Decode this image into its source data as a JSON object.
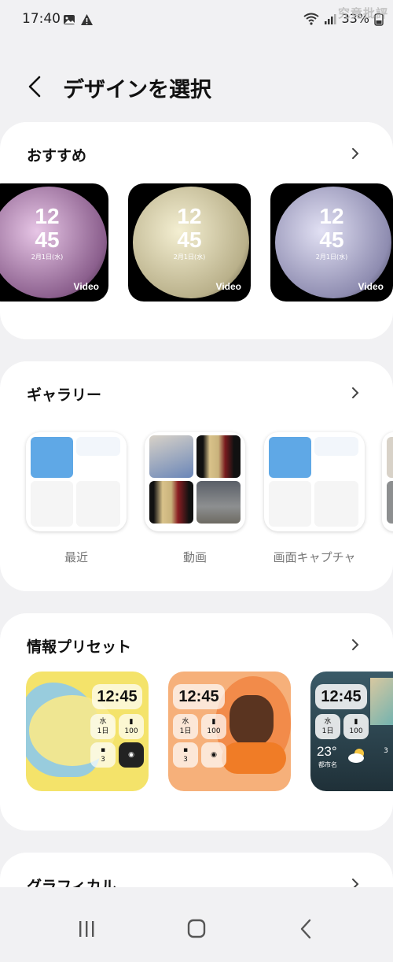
{
  "status": {
    "time": "17:40",
    "battery": "33%",
    "watermark": "究竟批評"
  },
  "header": {
    "title": "デザインを選択"
  },
  "sections": {
    "recommended": {
      "title": "おすすめ",
      "items": [
        {
          "time_h": "12",
          "time_m": "45",
          "date": "2月1日(水)",
          "badge": "Video",
          "tint": "#c9a6c9"
        },
        {
          "time_h": "12",
          "time_m": "45",
          "date": "2月1日(水)",
          "badge": "Video",
          "tint": "#d9d2b2"
        },
        {
          "time_h": "12",
          "time_m": "45",
          "date": "2月1日(水)",
          "badge": "Video",
          "tint": "#b8b6d4"
        }
      ]
    },
    "gallery": {
      "title": "ギャラリー",
      "items": [
        {
          "label": "最近"
        },
        {
          "label": "動画"
        },
        {
          "label": "画面キャプチャ"
        }
      ]
    },
    "presets": {
      "title": "情報プリセット",
      "items": [
        {
          "clock": "12:45",
          "day": "水",
          "date": "1日",
          "battery": "100",
          "count": "3",
          "bg": "#f4e36a"
        },
        {
          "clock": "12:45",
          "day": "水",
          "date": "1日",
          "battery": "100",
          "count": "3",
          "bg": "#f6b07a"
        },
        {
          "clock": "12:45",
          "day": "水",
          "date": "1日",
          "battery": "100",
          "temp": "23°",
          "city": "都市名",
          "count": "3",
          "bg": "#2f4a56"
        }
      ]
    },
    "graphical": {
      "title": "グラフィカル"
    }
  }
}
